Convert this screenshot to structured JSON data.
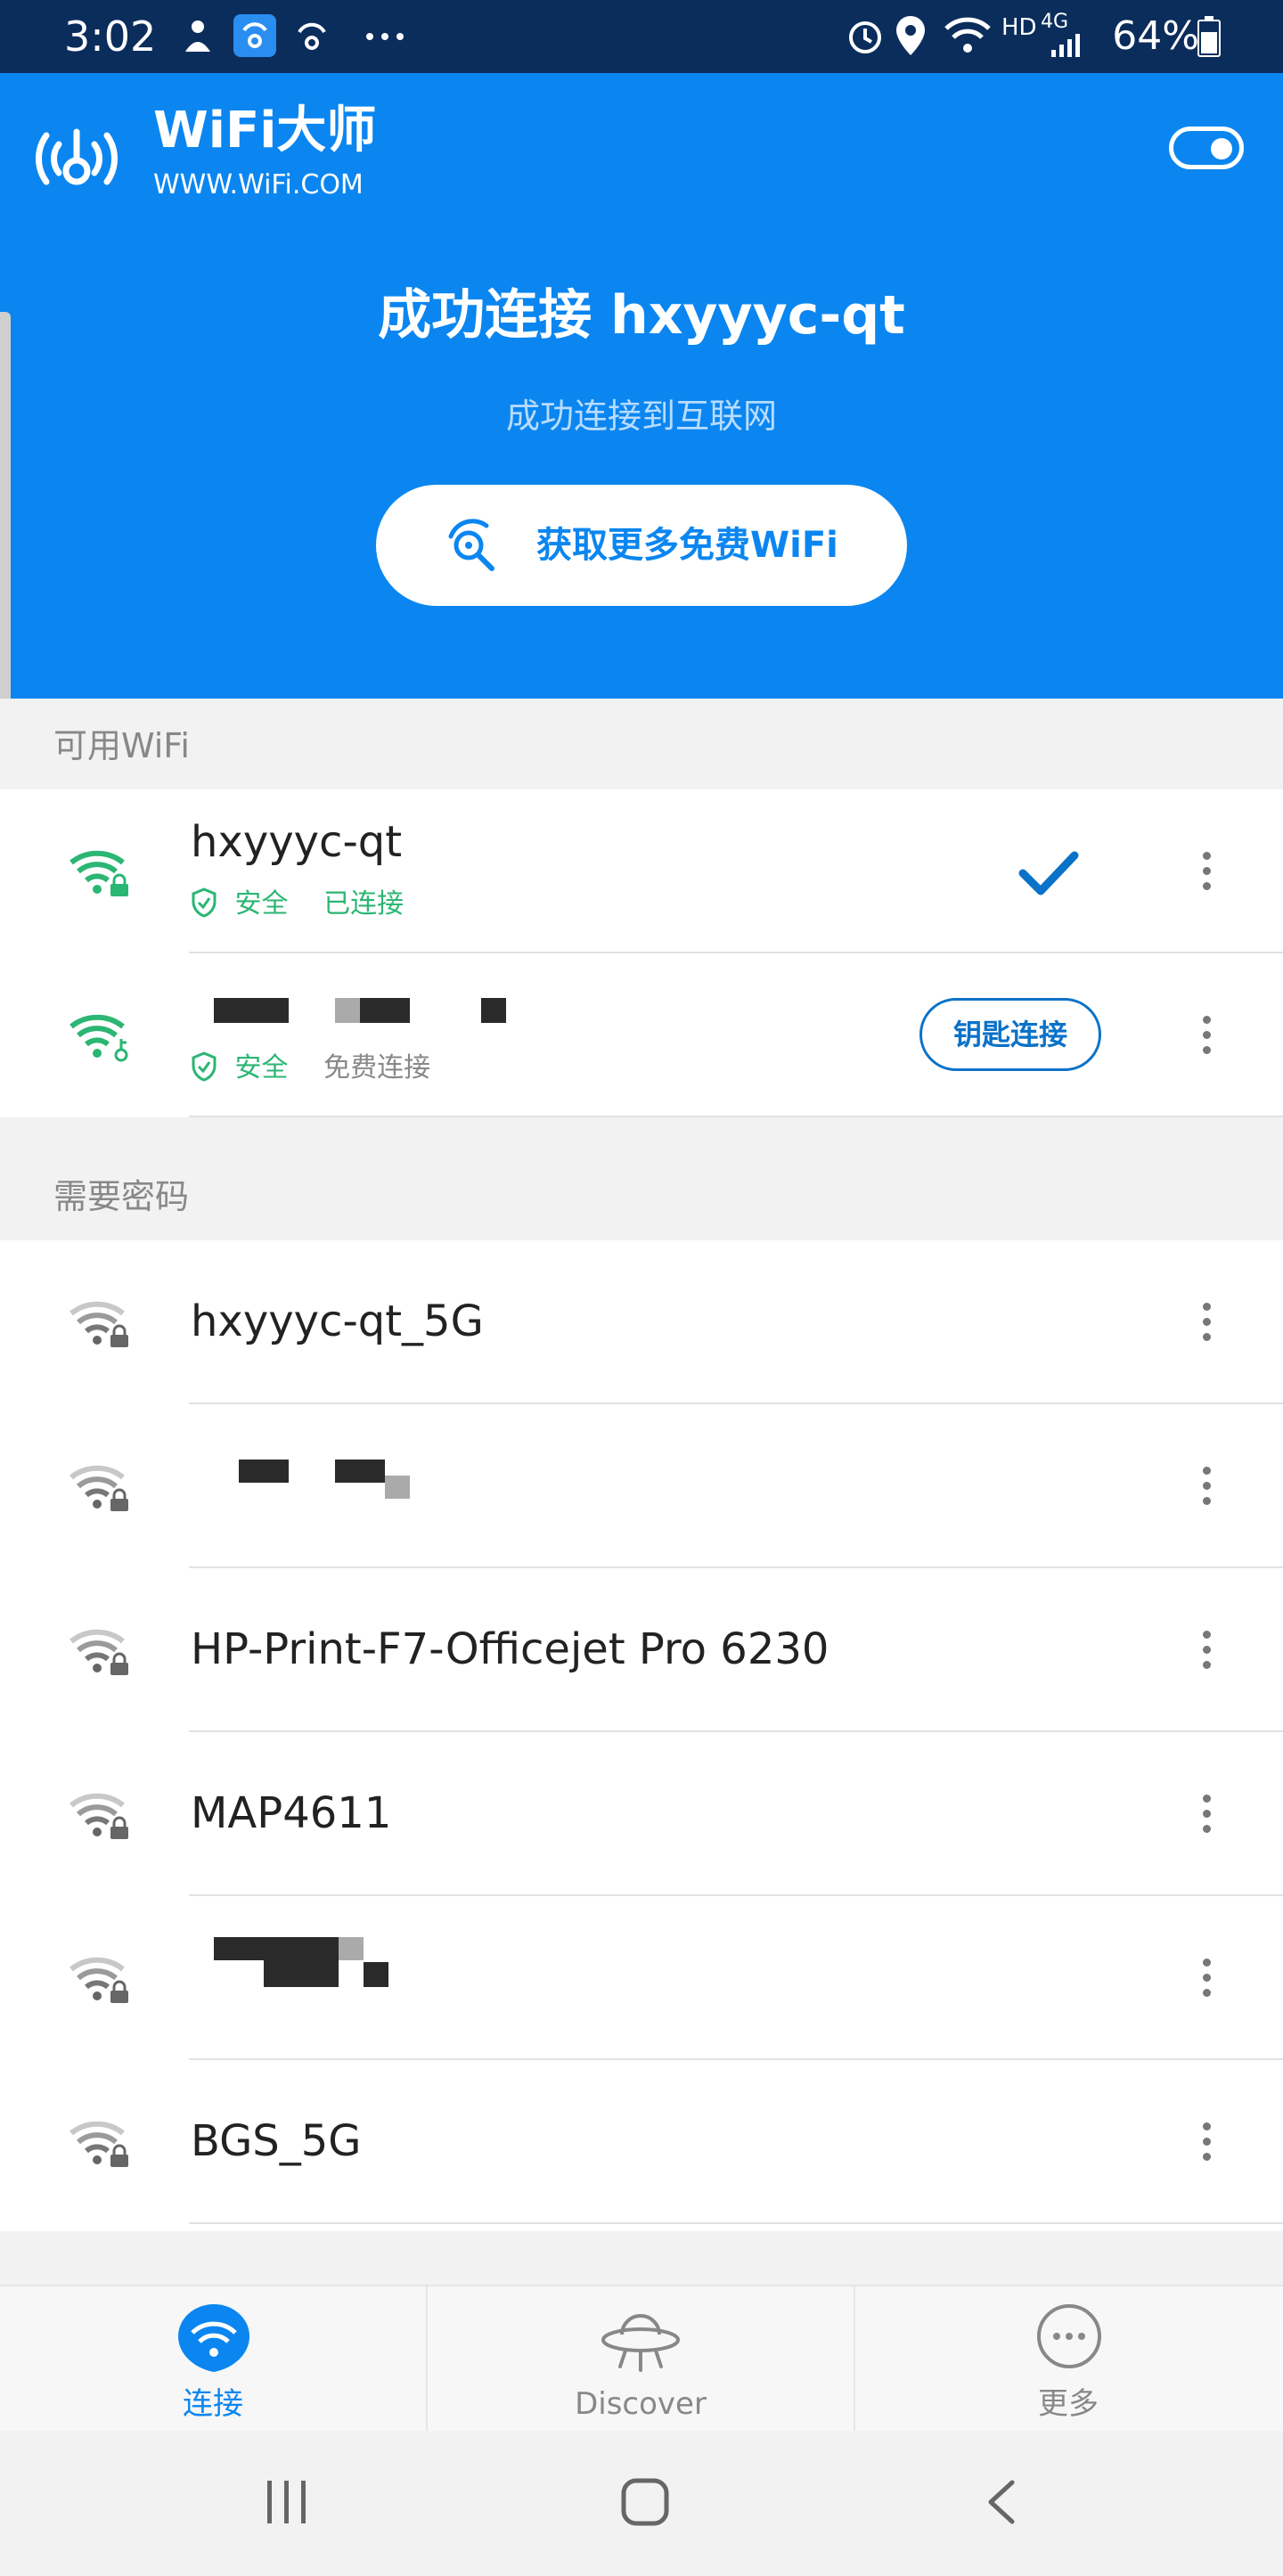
{
  "status_bar": {
    "time": "3:02",
    "network": "HD",
    "network_gen": "4G",
    "battery": "64%"
  },
  "header": {
    "app_title": "WiFi大师",
    "app_url": "WWW.WiFi.COM",
    "title": "成功连接 hxyyyc-qt",
    "subtitle": "成功连接到互联网",
    "cta_label": "获取更多免费WiFi"
  },
  "available": {
    "section_title": "可用WiFi",
    "networks": [
      {
        "ssid": "hxyyyc-qt",
        "security": "安全",
        "status": "已连接",
        "connected": true
      },
      {
        "ssid": "",
        "security": "安全",
        "status": "免费连接",
        "action": "钥匙连接"
      }
    ]
  },
  "password_required": {
    "section_title": "需要密码",
    "networks": [
      {
        "ssid": "hxyyyc-qt_5G"
      },
      {
        "ssid": ""
      },
      {
        "ssid": "HP-Print-F7-Officejet Pro 6230"
      },
      {
        "ssid": "MAP4611"
      },
      {
        "ssid": ""
      },
      {
        "ssid": "BGS_5G"
      }
    ]
  },
  "bottom_nav": {
    "items": [
      {
        "label": "连接",
        "active": true
      },
      {
        "label": "Discover",
        "active": false
      },
      {
        "label": "更多",
        "active": false
      }
    ]
  },
  "colors": {
    "brand_blue": "#0b86f0",
    "secure_green": "#2bb673",
    "status_bar": "#0b2d5c"
  }
}
